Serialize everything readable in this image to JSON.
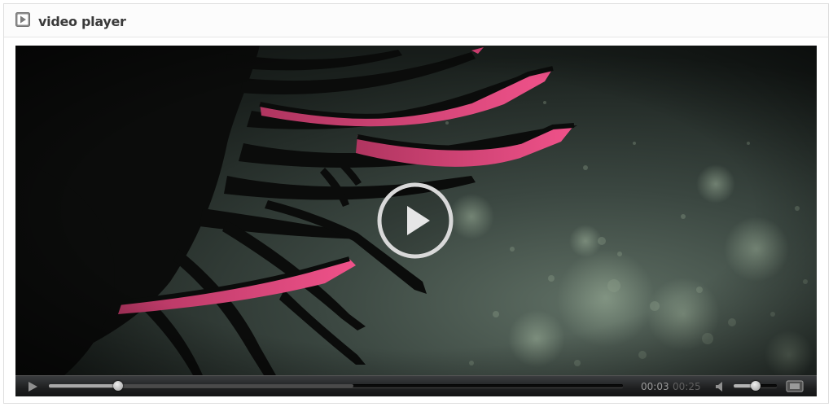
{
  "header": {
    "title": "video player",
    "icon": "play-square-icon"
  },
  "player": {
    "state": "paused",
    "big_play_icon": "play-circle-icon",
    "controls": {
      "play_icon": "play-icon",
      "current_time": "00:03",
      "duration": "00:25",
      "progress_fraction": 0.12,
      "buffered_fraction": 0.53,
      "volume_icon": "speaker-icon",
      "volume_fraction": 0.51,
      "fullscreen_icon": "fullscreen-icon"
    }
  },
  "colors": {
    "accent_pink": "#e8457e",
    "video_bg": "#2b3430",
    "controls_bg": "#1e1f20"
  }
}
